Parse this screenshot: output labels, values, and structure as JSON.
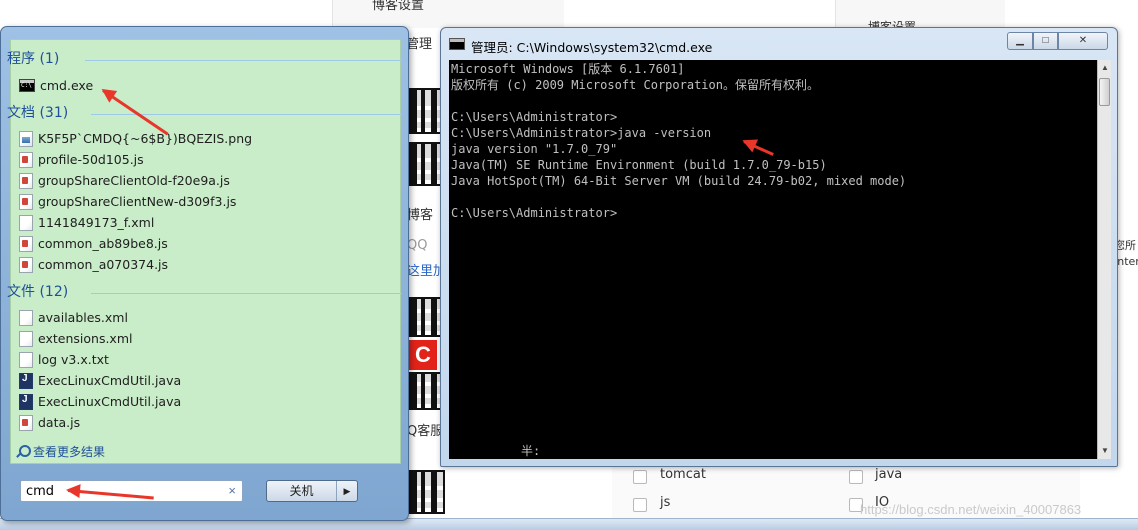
{
  "background": {
    "top_snippets": [
      "博客设置",
      "管理",
      "博客设置"
    ],
    "side_snippets": [
      "博客",
      "QQ",
      "这里加",
      "Q客服"
    ],
    "right_snippets": [
      "您所",
      "Inter"
    ],
    "checkboxes": [
      "tomcat",
      "java",
      "js",
      "IO"
    ],
    "watermark": "https://blog.csdn.net/weixin_40007863"
  },
  "start_menu": {
    "groups": [
      {
        "title": "程序 (1)",
        "items": [
          {
            "label": "cmd.exe",
            "icon": "cmd"
          }
        ]
      },
      {
        "title": "文档 (31)",
        "items": [
          {
            "label": "K5F5P`CMDQ{~6$B})BQEZIS.png",
            "icon": "png"
          },
          {
            "label": "profile-50d105.js",
            "icon": "js"
          },
          {
            "label": "groupShareClientOld-f20e9a.js",
            "icon": "js"
          },
          {
            "label": "groupShareClientNew-d309f3.js",
            "icon": "js"
          },
          {
            "label": "1141849173_f.xml",
            "icon": "xml"
          },
          {
            "label": "common_ab89be8.js",
            "icon": "js"
          },
          {
            "label": "common_a070374.js",
            "icon": "js"
          }
        ]
      },
      {
        "title": "文件 (12)",
        "items": [
          {
            "label": "availables.xml",
            "icon": "xml"
          },
          {
            "label": "extensions.xml",
            "icon": "xml"
          },
          {
            "label": "log v3.x.txt",
            "icon": "txt"
          },
          {
            "label": "ExecLinuxCmdUtil.java",
            "icon": "java"
          },
          {
            "label": "ExecLinuxCmdUtil.java",
            "icon": "java"
          },
          {
            "label": "data.js",
            "icon": "js"
          }
        ]
      }
    ],
    "see_more": "查看更多结果",
    "search_value": "cmd",
    "search_clear": "×",
    "shutdown_label": "关机",
    "shutdown_arrow": "▶"
  },
  "cmd_window": {
    "title": "管理员: C:\\Windows\\system32\\cmd.exe",
    "buttons": {
      "minimize": "▁",
      "maximize": "□",
      "close": "✕"
    },
    "lines": [
      "Microsoft Windows [版本 6.1.7601]",
      "版权所有 (c) 2009 Microsoft Corporation。保留所有权利。",
      "",
      "C:\\Users\\Administrator>",
      "C:\\Users\\Administrator>java -version",
      "java version \"1.7.0_79\"",
      "Java(TM) SE Runtime Environment (build 1.7.0_79-b15)",
      "Java HotSpot(TM) 64-Bit Server VM (build 24.79-b02, mixed mode)",
      "",
      "C:\\Users\\Administrator>"
    ],
    "ime_status": "半:",
    "scroll_up": "▲",
    "scroll_down": "▼"
  },
  "colors": {
    "accent_arrow": "#e8362b",
    "results_bg": "#c9ecc9",
    "console_bg": "#000000",
    "console_text": "#c0c0c0"
  }
}
